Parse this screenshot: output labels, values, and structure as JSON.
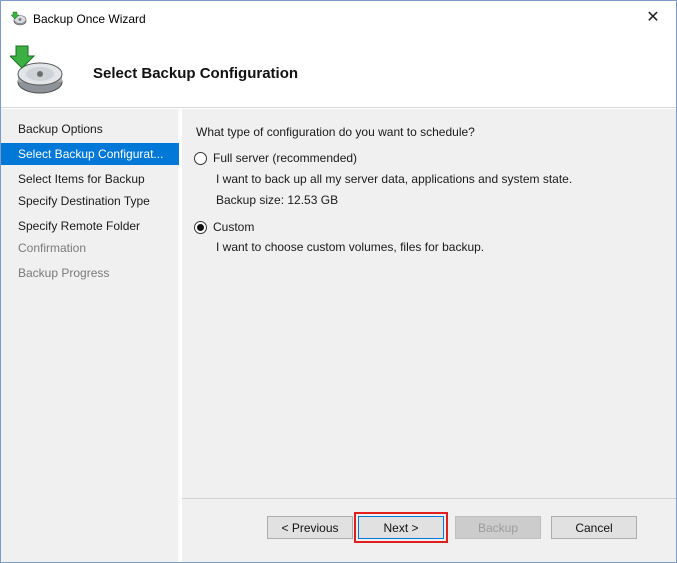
{
  "window": {
    "title": "Backup Once Wizard",
    "close_glyph": "✕"
  },
  "header": {
    "title": "Select Backup Configuration"
  },
  "sidebar": {
    "items": [
      {
        "label": "Backup Options",
        "state": "normal"
      },
      {
        "label": "Select Backup Configurat...",
        "state": "active"
      },
      {
        "label": "Select Items for Backup",
        "state": "normal"
      },
      {
        "label": "Specify Destination Type",
        "state": "normal"
      },
      {
        "label": "Specify Remote Folder",
        "state": "normal"
      },
      {
        "label": "Confirmation",
        "state": "disabled"
      },
      {
        "label": "Backup Progress",
        "state": "disabled"
      }
    ]
  },
  "main": {
    "question": "What type of configuration do you want to schedule?",
    "options": [
      {
        "label": "Full server (recommended)",
        "checked": false,
        "description": "I want to back up all my server data, applications and system state.",
        "detail": "Backup size: 12.53 GB"
      },
      {
        "label": "Custom",
        "checked": true,
        "description": "I want to choose custom volumes, files for backup."
      }
    ]
  },
  "footer": {
    "previous_label": "< Previous",
    "next_label": "Next >",
    "backup_label": "Backup",
    "cancel_label": "Cancel"
  },
  "colors": {
    "accent": "#0078d7",
    "highlight": "#e02020",
    "panel": "#f0f0f0"
  },
  "icons": {
    "title_icon": "backup-disk-icon",
    "header_icon": "backup-disk-arrow-icon"
  }
}
